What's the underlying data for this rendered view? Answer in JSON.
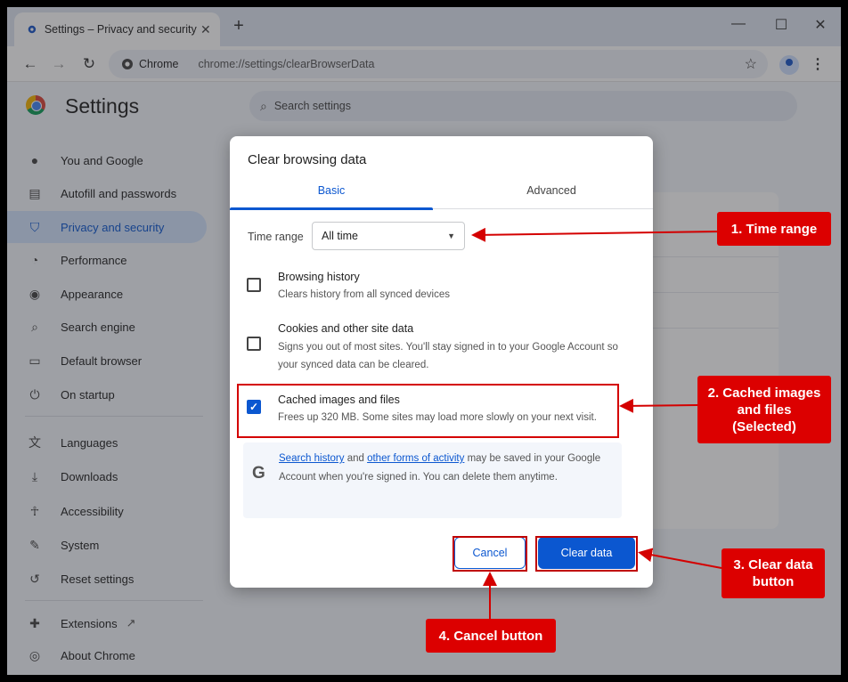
{
  "browser": {
    "tab_title": "Settings – Privacy and security",
    "tab_close": "✕",
    "new_tab": "+",
    "minimize": "—",
    "maximize": "☐",
    "close": "✕",
    "omnibox_chip": "Chrome",
    "omnibox_url": "chrome://settings/clearBrowserData"
  },
  "settings": {
    "title": "Settings",
    "search_placeholder": "Search settings",
    "nav": [
      {
        "label": "You and Google",
        "icon": "person-icon"
      },
      {
        "label": "Autofill and passwords",
        "icon": "clipboard-icon"
      },
      {
        "label": "Privacy and security",
        "icon": "shield-icon",
        "active": true
      },
      {
        "label": "Performance",
        "icon": "speedometer-icon"
      },
      {
        "label": "Appearance",
        "icon": "palette-icon"
      },
      {
        "label": "Search engine",
        "icon": "search-icon"
      },
      {
        "label": "Default browser",
        "icon": "browser-icon"
      },
      {
        "label": "On startup",
        "icon": "power-icon"
      },
      {
        "label": "Languages",
        "icon": "translate-icon"
      },
      {
        "label": "Downloads",
        "icon": "download-icon"
      },
      {
        "label": "Accessibility",
        "icon": "accessibility-icon"
      },
      {
        "label": "System",
        "icon": "wrench-icon"
      },
      {
        "label": "Reset settings",
        "icon": "reset-icon"
      },
      {
        "label": "Extensions",
        "icon": "puzzle-icon"
      },
      {
        "label": "About Chrome",
        "icon": "chrome-icon"
      }
    ]
  },
  "dialog": {
    "title": "Clear browsing data",
    "tabs": [
      "Basic",
      "Advanced"
    ],
    "time_range_label": "Time range",
    "time_range_value": "All time",
    "options": [
      {
        "title": "Browsing history",
        "desc": "Clears history from all synced devices",
        "checked": false
      },
      {
        "title": "Cookies and other site data",
        "desc": "Signs you out of most sites. You'll stay signed in to your Google Account so your synced data can be cleared.",
        "checked": false
      },
      {
        "title": "Cached images and files",
        "desc": "Frees up 320 MB. Some sites may load more slowly on your next visit.",
        "checked": true
      }
    ],
    "info": {
      "link1": "Search history",
      "and": " and ",
      "link2": "other forms of activity",
      "rest": " may be saved in your Google Account when you're signed in. You can delete them anytime."
    },
    "cancel": "Cancel",
    "clear": "Clear data"
  },
  "annotations": {
    "a1": "1. Time range",
    "a2_line1": "2. Cached images",
    "a2_line2": "and files",
    "a2_line3": "(Selected)",
    "a3_line1": "3. Clear data",
    "a3_line2": "button",
    "a4": "4. Cancel button",
    "color": "#dc0000"
  }
}
